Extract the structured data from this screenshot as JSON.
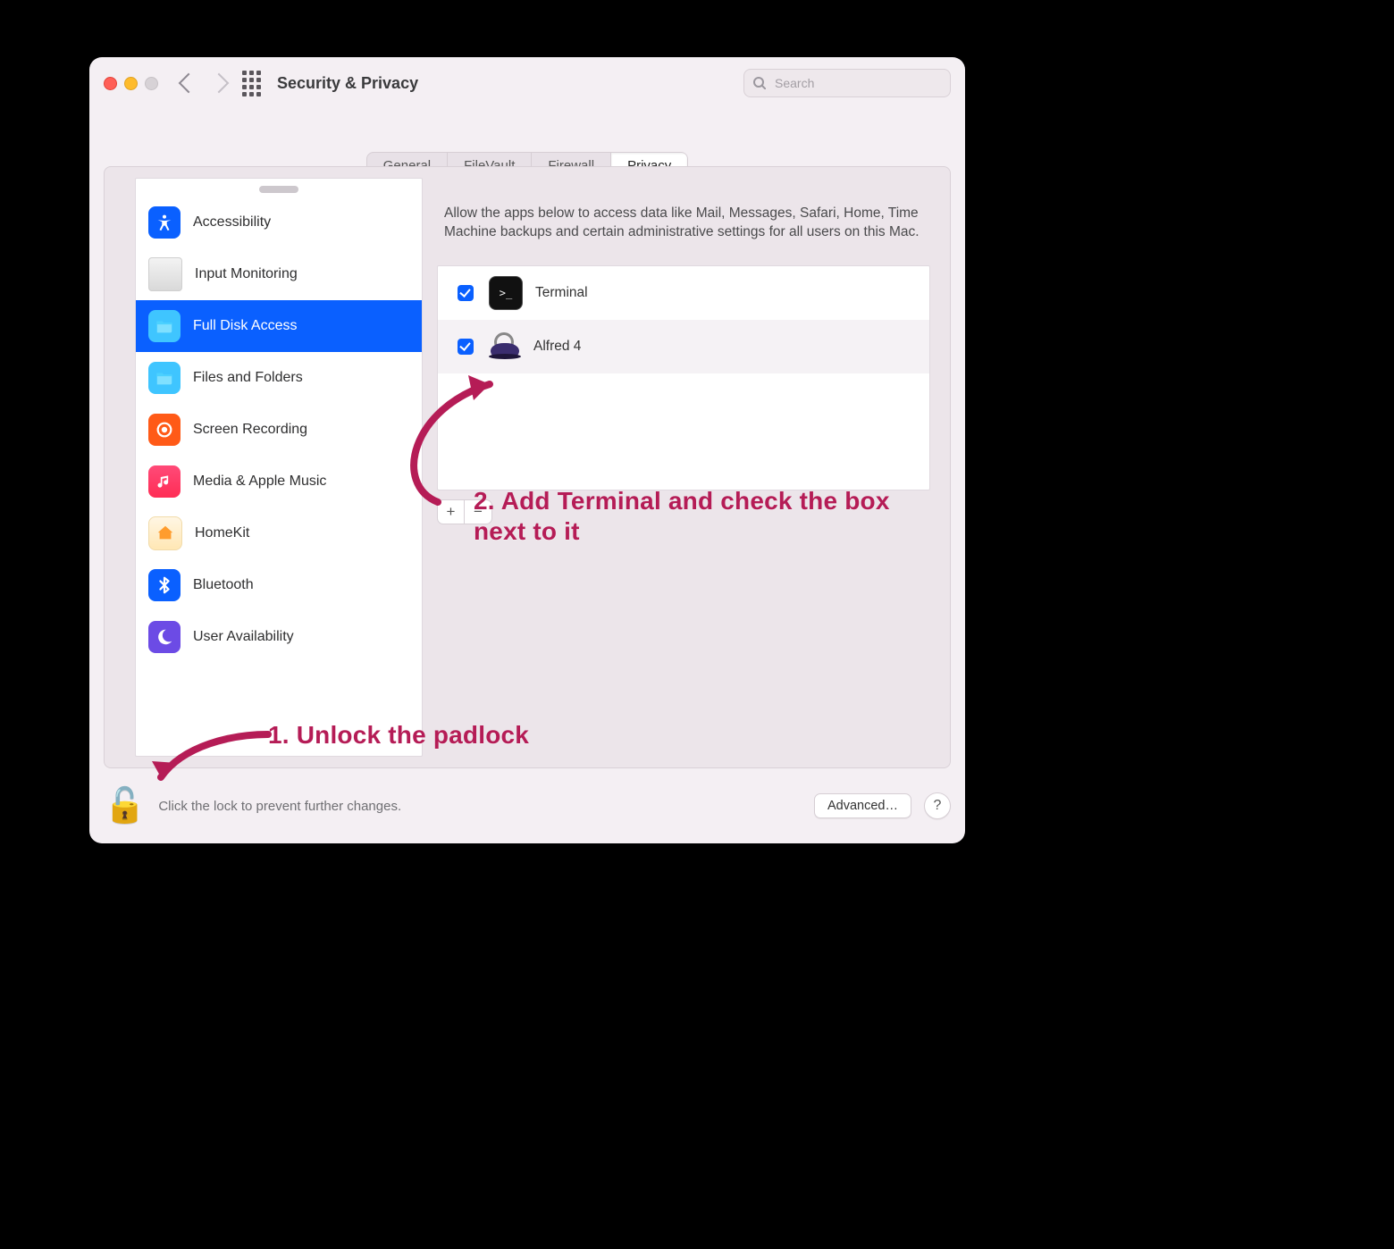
{
  "window": {
    "title": "Security & Privacy",
    "search_placeholder": "Search"
  },
  "tabs": [
    {
      "label": "General",
      "active": false
    },
    {
      "label": "FileVault",
      "active": false
    },
    {
      "label": "Firewall",
      "active": false
    },
    {
      "label": "Privacy",
      "active": true
    }
  ],
  "sidebar": {
    "items": [
      {
        "label": "Accessibility",
        "icon": "accessibility"
      },
      {
        "label": "Input Monitoring",
        "icon": "keyboard"
      },
      {
        "label": "Full Disk Access",
        "icon": "folder",
        "selected": true
      },
      {
        "label": "Files and Folders",
        "icon": "folder"
      },
      {
        "label": "Screen Recording",
        "icon": "record"
      },
      {
        "label": "Media & Apple Music",
        "icon": "music"
      },
      {
        "label": "HomeKit",
        "icon": "home"
      },
      {
        "label": "Bluetooth",
        "icon": "bluetooth"
      },
      {
        "label": "User Availability",
        "icon": "moon"
      }
    ]
  },
  "content": {
    "description": "Allow the apps below to access data like Mail, Messages, Safari, Home, Time Machine backups and certain administrative settings for all users on this Mac.",
    "apps": [
      {
        "name": "Terminal",
        "checked": true,
        "icon": "terminal"
      },
      {
        "name": "Alfred 4",
        "checked": true,
        "icon": "alfred"
      }
    ],
    "add_label": "+",
    "remove_label": "−"
  },
  "footer": {
    "lock_text": "Click the lock to prevent further changes.",
    "advanced_label": "Advanced…",
    "help_label": "?"
  },
  "annotations": {
    "step1": "1. Unlock the padlock",
    "step2": "2. Add Terminal and check the box next to it"
  }
}
